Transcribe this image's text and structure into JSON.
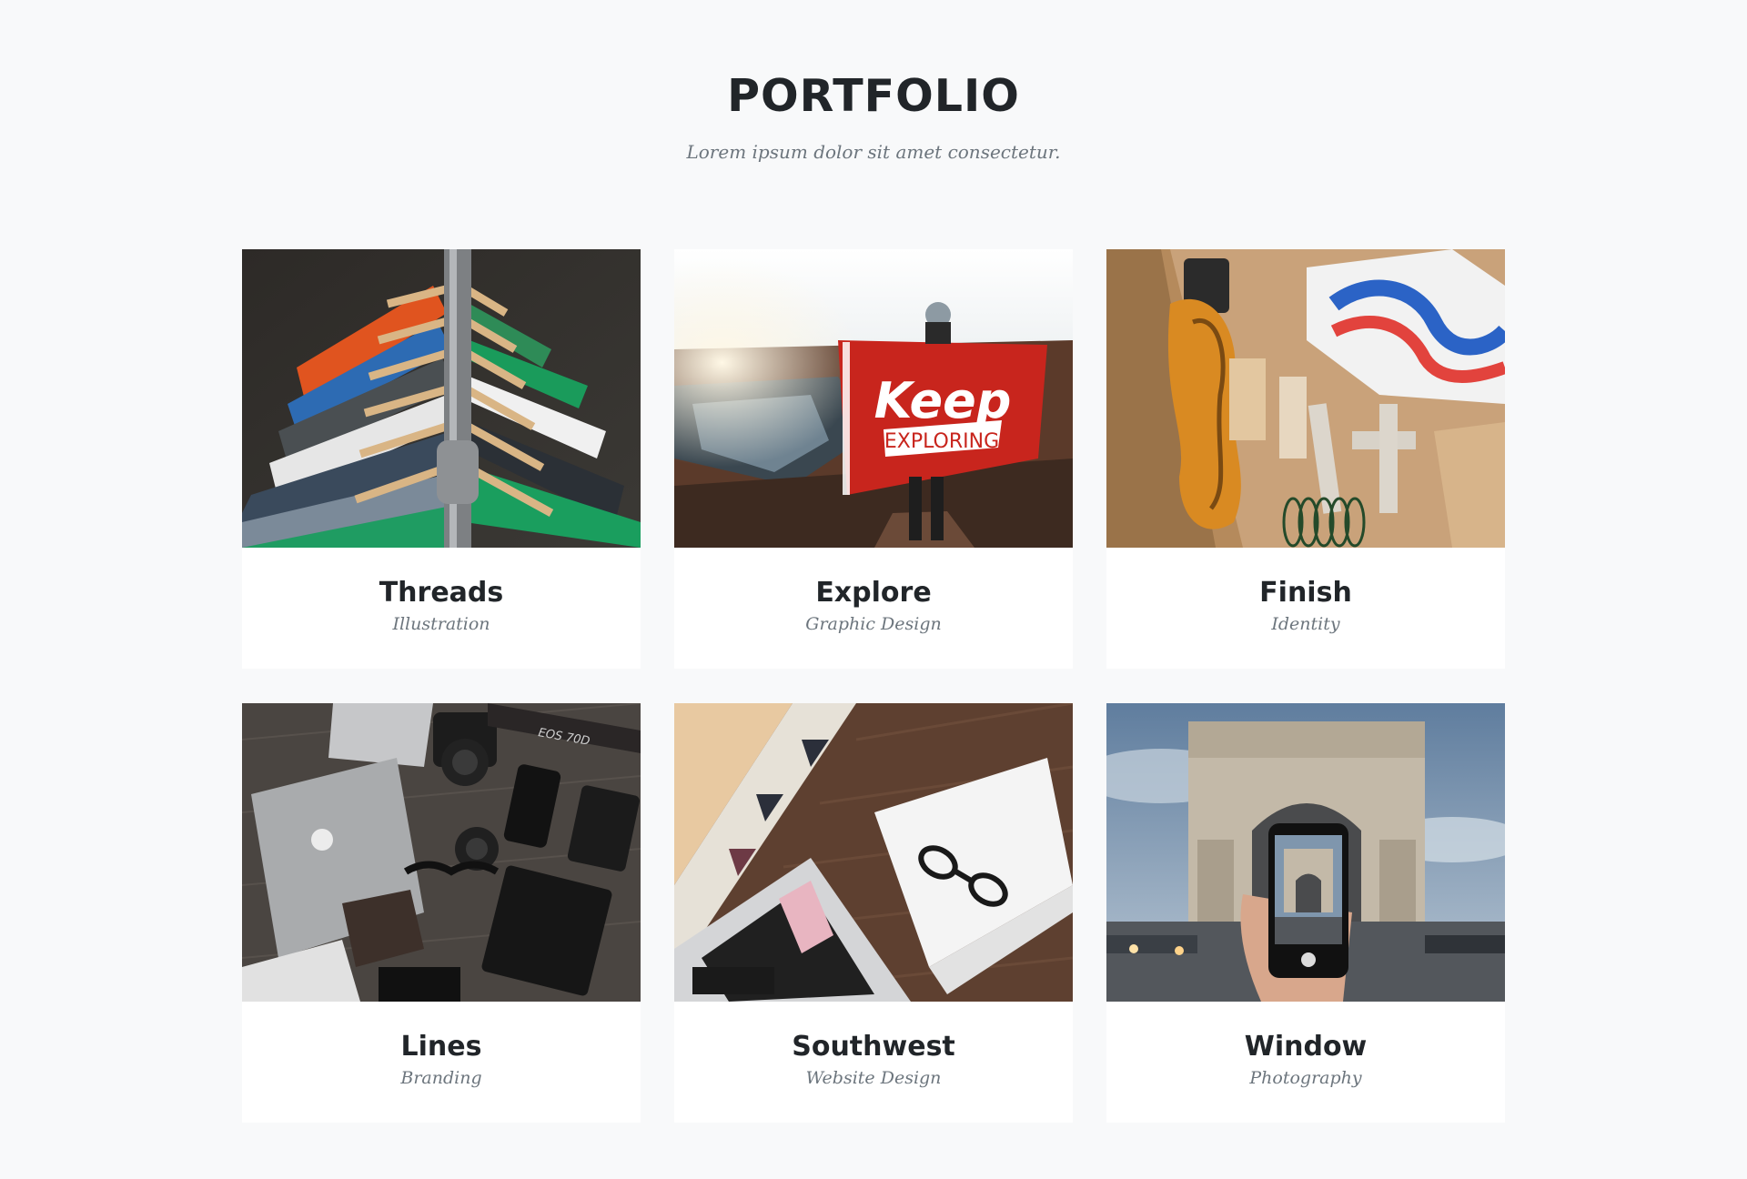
{
  "portfolio": {
    "heading": "PORTFOLIO",
    "subheading": "Lorem ipsum dolor sit amet consectetur.",
    "items": [
      {
        "title": "Threads",
        "category": "Illustration",
        "image": "clothing-rack-photo"
      },
      {
        "title": "Explore",
        "category": "Graphic Design",
        "image": "keep-exploring-flag-photo",
        "flag_text_1": "Keep",
        "flag_text_2": "EXPLORING"
      },
      {
        "title": "Finish",
        "category": "Identity",
        "image": "guitar-body-workbench-photo"
      },
      {
        "title": "Lines",
        "category": "Branding",
        "image": "laptop-camera-flatlay-photo",
        "camera_text": "EOS 70D"
      },
      {
        "title": "Southwest",
        "category": "Website Design",
        "image": "laptop-notebook-glasses-photo"
      },
      {
        "title": "Window",
        "category": "Photography",
        "image": "arc-de-triomphe-phone-photo"
      }
    ]
  },
  "colors": {
    "background": "#f8f9fa",
    "card": "#ffffff",
    "heading": "#212529",
    "muted": "#6c757d"
  }
}
